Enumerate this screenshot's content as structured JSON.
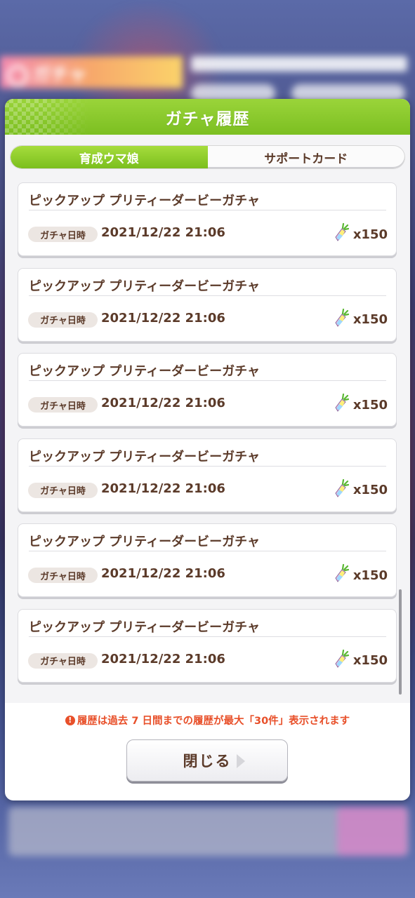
{
  "background": {
    "banner_label": "ガチャ"
  },
  "dialog": {
    "title": "ガチャ履歴",
    "tabs": [
      {
        "label": "育成ウマ娘",
        "active": true
      },
      {
        "label": "サポートカード",
        "active": false
      }
    ],
    "entries": [
      {
        "title": "ピックアップ プリティーダービーガチャ",
        "date_label": "ガチャ日時",
        "date": "2021/12/22 21:06",
        "cost": "x150",
        "cost_icon": "carrot-icon"
      },
      {
        "title": "ピックアップ プリティーダービーガチャ",
        "date_label": "ガチャ日時",
        "date": "2021/12/22 21:06",
        "cost": "x150",
        "cost_icon": "carrot-icon"
      },
      {
        "title": "ピックアップ プリティーダービーガチャ",
        "date_label": "ガチャ日時",
        "date": "2021/12/22 21:06",
        "cost": "x150",
        "cost_icon": "carrot-icon"
      },
      {
        "title": "ピックアップ プリティーダービーガチャ",
        "date_label": "ガチャ日時",
        "date": "2021/12/22 21:06",
        "cost": "x150",
        "cost_icon": "carrot-icon"
      },
      {
        "title": "ピックアップ プリティーダービーガチャ",
        "date_label": "ガチャ日時",
        "date": "2021/12/22 21:06",
        "cost": "x150",
        "cost_icon": "carrot-icon"
      },
      {
        "title": "ピックアップ プリティーダービーガチャ",
        "date_label": "ガチャ日時",
        "date": "2021/12/22 21:06",
        "cost": "x150",
        "cost_icon": "carrot-icon"
      }
    ],
    "notice": "履歴は過去 7 日間までの履歴が最大「30件」表示されます",
    "notice_icon": "!",
    "close_label": "閉じる"
  },
  "colors": {
    "header_green": "#7cbf21",
    "text_brown": "#5b3a29",
    "notice_orange": "#e8502a"
  }
}
